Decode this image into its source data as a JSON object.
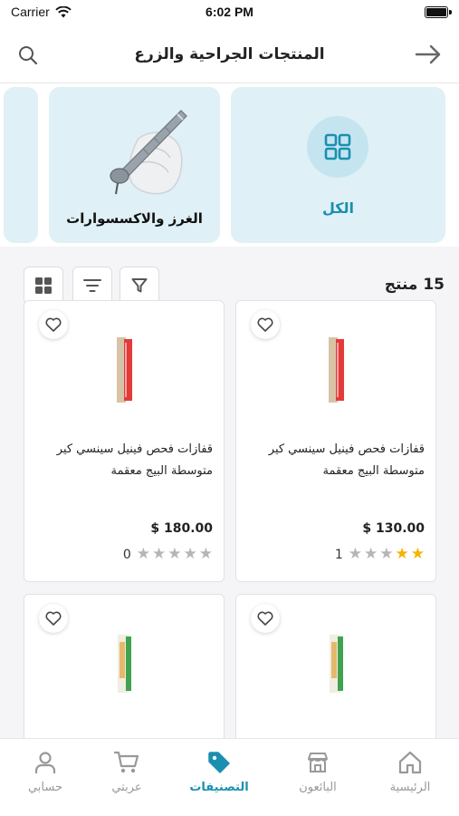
{
  "status_bar": {
    "carrier": "Carrier",
    "time": "6:02 PM"
  },
  "header": {
    "title": "المنتجات الجراحية والزرع"
  },
  "categories": [
    {
      "label": "الكل",
      "icon": "grid-icon",
      "color": "#1a8fb0"
    },
    {
      "label": "الغرز والاكسسوارات",
      "icon": "handpiece-image"
    }
  ],
  "toolbar": {
    "count": "15 منتج"
  },
  "products": [
    {
      "name": "قفازات فحص فينيل سينسي كير متوسطة البيج معقمة",
      "price": "$ 130.00",
      "rating": 1,
      "rating_count": "1"
    },
    {
      "name": "قفازات فحص فينيل سينسي كير متوسطة البيج معقمة",
      "price": "$ 180.00",
      "rating": 0,
      "rating_count": "0"
    },
    {
      "name": "",
      "price": "",
      "rating": null,
      "rating_count": ""
    },
    {
      "name": "",
      "price": "",
      "rating": null,
      "rating_count": ""
    }
  ],
  "bottom_nav": [
    {
      "label": "الرئيسية",
      "icon": "home-icon"
    },
    {
      "label": "البائعون",
      "icon": "store-icon"
    },
    {
      "label": "التصنيفات",
      "icon": "tag-icon",
      "active": true
    },
    {
      "label": "عربتي",
      "icon": "cart-icon"
    },
    {
      "label": "حسابي",
      "icon": "user-icon"
    }
  ],
  "colors": {
    "accent": "#1a8fb0",
    "star": "#f4b400",
    "category_bg": "#dff0f6"
  }
}
